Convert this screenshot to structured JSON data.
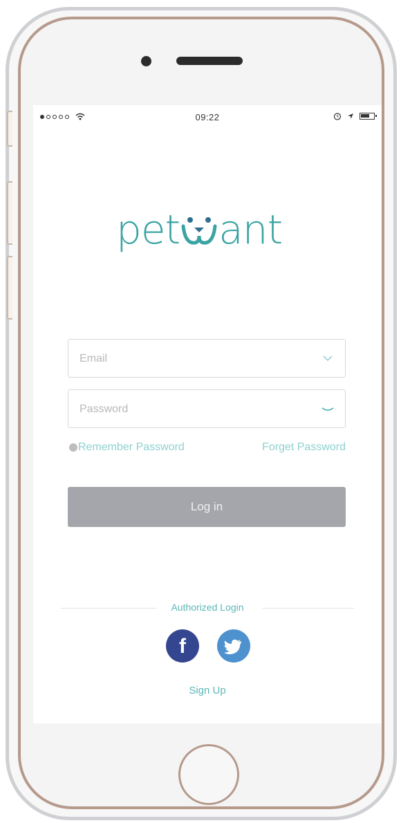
{
  "status_bar": {
    "carrier_signal": "●○○○○",
    "time": "09:22",
    "icons": [
      "wifi-icon",
      "alarm-icon",
      "location-icon",
      "battery-icon"
    ]
  },
  "logo": {
    "left_text": "pet",
    "right_text": "ant",
    "mark": "dog-face-w-mark"
  },
  "colors": {
    "brand_teal": "#3aa3a3",
    "link_teal": "#8fd0cf",
    "button_gray": "#a4a6ab",
    "facebook_blue": "#34468f",
    "twitter_blue": "#4d92cf"
  },
  "form": {
    "email": {
      "placeholder": "Email",
      "value": ""
    },
    "password": {
      "placeholder": "Password",
      "value": ""
    },
    "remember_label": "Remember Password",
    "forget_label": "Forget Password",
    "login_label": "Log in"
  },
  "social": {
    "label": "Authorized Login",
    "facebook_glyph": "f",
    "twitter_icon": "twitter-bird-icon"
  },
  "signup_label": "Sign Up"
}
